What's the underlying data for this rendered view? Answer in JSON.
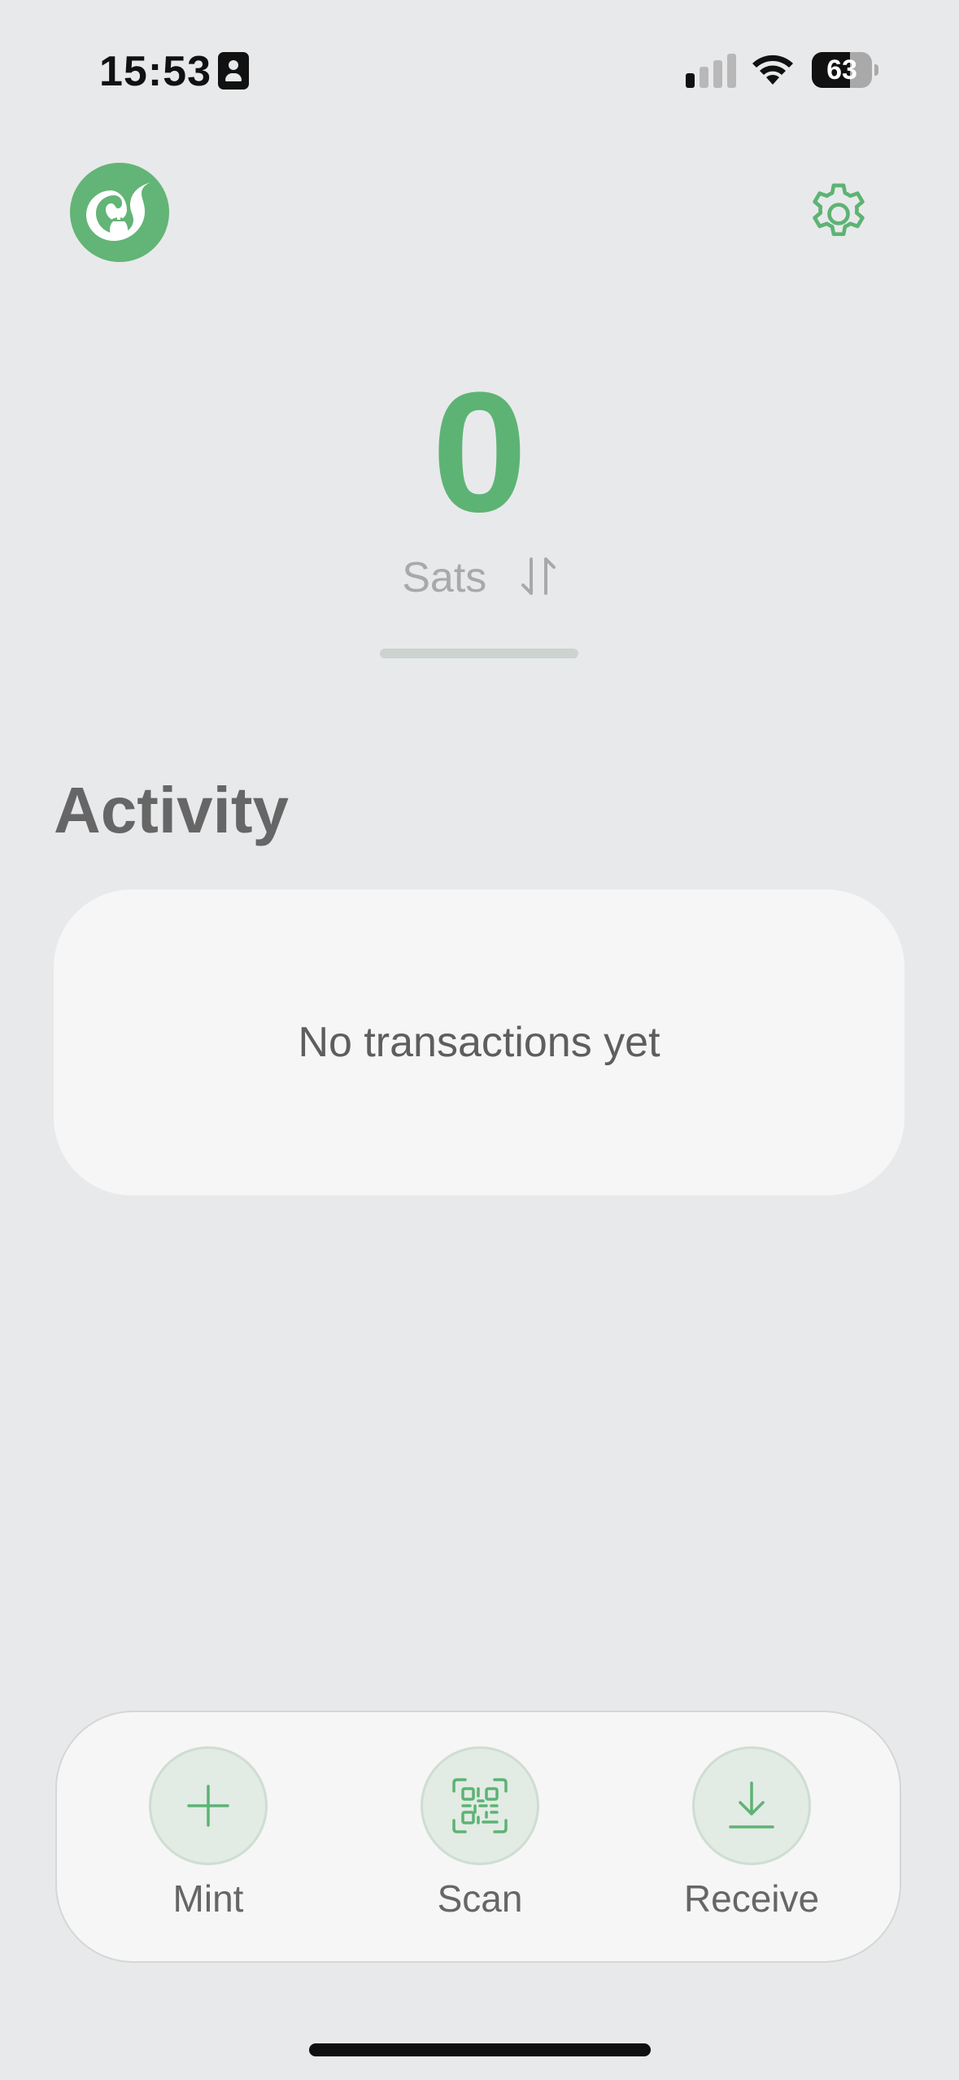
{
  "status_bar": {
    "time": "15:53",
    "battery_percent": "63",
    "battery_level": 0.63
  },
  "header": {
    "logo_icon": "squirrel-acorn-logo-icon",
    "settings_icon": "gear-icon"
  },
  "balance": {
    "amount": "0",
    "unit": "Sats",
    "swap_icon": "swap-vertical-icon"
  },
  "activity": {
    "title": "Activity",
    "empty_text": "No transactions yet"
  },
  "actions": [
    {
      "label": "Mint",
      "icon": "plus-icon"
    },
    {
      "label": "Scan",
      "icon": "qr-scan-icon"
    },
    {
      "label": "Receive",
      "icon": "download-icon"
    }
  ],
  "colors": {
    "accent": "#5DB374",
    "background": "#E8E9EB",
    "card": "#F6F6F6",
    "muted_text": "#A7A9AB"
  }
}
